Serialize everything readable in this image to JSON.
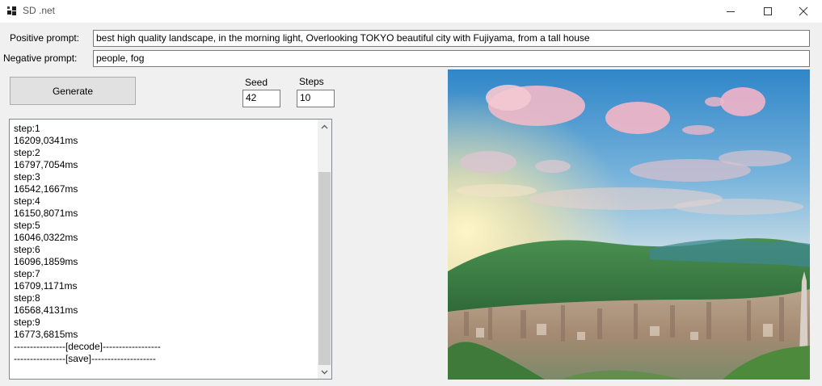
{
  "window": {
    "title": "SD .net"
  },
  "form": {
    "positive_label": "Positive prompt:",
    "positive_value": "best high quality landscape, in the morning light, Overlooking TOKYO beautiful city with Fujiyama,  from a tall house",
    "negative_label": "Negative prompt:",
    "negative_value": "people, fog",
    "generate_label": "Generate",
    "seed_label": "Seed",
    "seed_value": "42",
    "steps_label": "Steps",
    "steps_value": "10"
  },
  "log": {
    "lines": [
      "step:1",
      "16209,0341ms",
      "step:2",
      "16797,7054ms",
      "step:3",
      "16542,1667ms",
      "step:4",
      "16150,8071ms",
      "step:5",
      "16046,0322ms",
      "step:6",
      "16096,1859ms",
      "step:7",
      "16709,1171ms",
      "step:8",
      "16568,4131ms",
      "step:9",
      "16773,6815ms",
      "----------------[decode]------------------",
      "----------------[save]--------------------"
    ]
  },
  "icons": {
    "app": "app-icon",
    "minimize": "minimize-icon",
    "maximize": "maximize-icon",
    "close": "close-icon",
    "scroll_up": "chevron-up-icon",
    "scroll_down": "chevron-down-icon"
  },
  "image": {
    "subject": "generated landscape image"
  }
}
